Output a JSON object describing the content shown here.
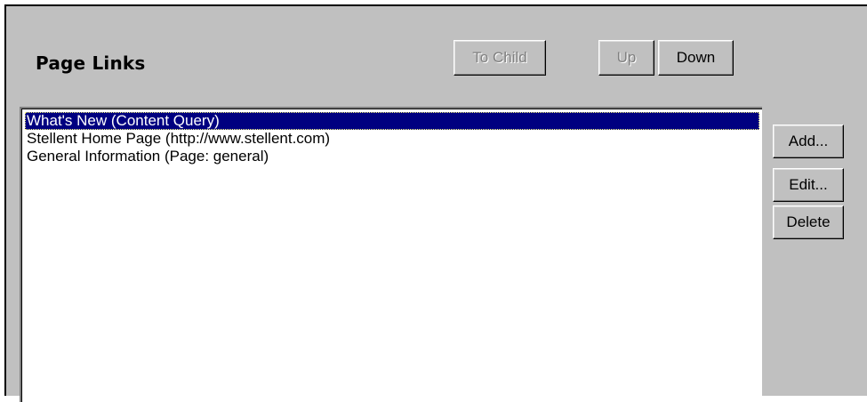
{
  "header": {
    "title": "Page Links"
  },
  "toolbar": {
    "to_child_label": "To Child",
    "up_label": "Up",
    "down_label": "Down"
  },
  "links_list": {
    "items": [
      {
        "label": "What's New (Content Query)",
        "selected": true
      },
      {
        "label": "Stellent Home Page (http://www.stellent.com)",
        "selected": false
      },
      {
        "label": "General Information (Page: general)",
        "selected": false
      }
    ]
  },
  "side_buttons": {
    "add_label": "Add...",
    "edit_label": "Edit...",
    "delete_label": "Delete"
  },
  "colors": {
    "panel_background": "#c0c0c0",
    "selection_background": "#000080",
    "selection_text": "#ffffff",
    "disabled_text": "#808080"
  }
}
